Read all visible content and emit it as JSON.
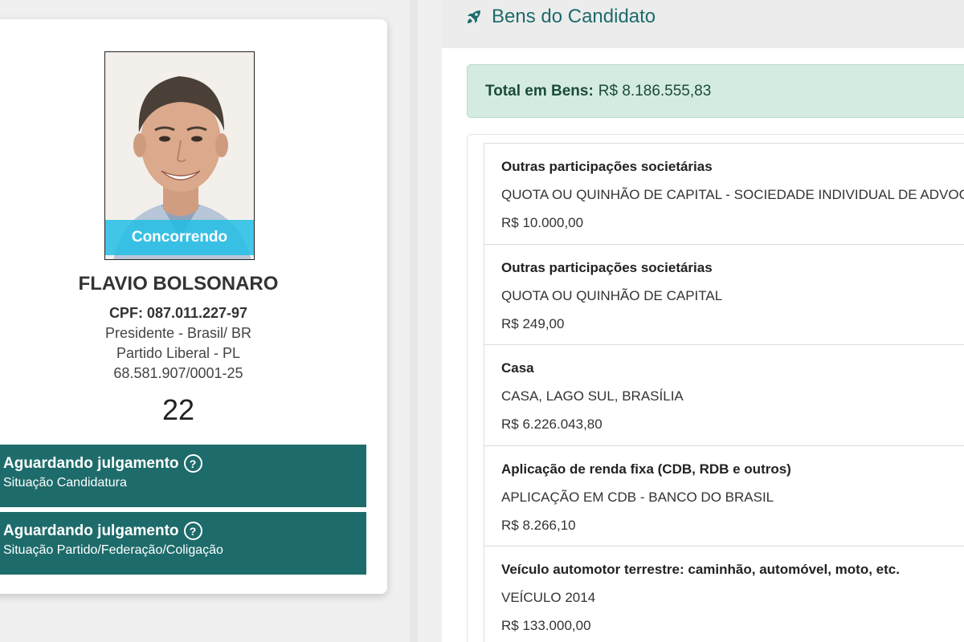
{
  "candidate": {
    "status_ribbon": "Concorrendo",
    "name": "FLAVIO BOLSONARO",
    "cpf": "CPF: 087.011.227-97",
    "role": "Presidente - Brasil/ BR",
    "party": "Partido Liberal - PL",
    "cnpj": "68.581.907/0001-25",
    "number": "22"
  },
  "situations": [
    {
      "title": "Aguardando julgamento",
      "subtitle": "Situação Candidatura",
      "icon": "question-circle-icon"
    },
    {
      "title": "Aguardando julgamento",
      "subtitle": "Situação Partido/Federação/Coligação",
      "icon": "question-circle-icon"
    }
  ],
  "assets_panel": {
    "icon": "rocket-icon",
    "title": "Bens do Candidato",
    "total_label": "Total em Bens:",
    "total_value": "R$ 8.186.555,83",
    "items": [
      {
        "type": "Outras participações societárias",
        "description": "QUOTA OU QUINHÃO DE CAPITAL - SOCIEDADE INDIVIDUAL DE ADVOCA",
        "value": "R$ 10.000,00"
      },
      {
        "type": "Outras participações societárias",
        "description": "QUOTA OU QUINHÃO DE CAPITAL",
        "value": "R$ 249,00"
      },
      {
        "type": "Casa",
        "description": "CASA, LAGO SUL, BRASÍLIA",
        "value": "R$ 6.226.043,80"
      },
      {
        "type": "Aplicação de renda fixa (CDB, RDB e outros)",
        "description": "APLICAÇÃO EM CDB - BANCO DO BRASIL",
        "value": "R$ 8.266,10"
      },
      {
        "type": "Veículo automotor terrestre: caminhão, automóvel, moto, etc.",
        "description": "VEÍCULO 2014",
        "value": "R$ 133.000,00"
      }
    ]
  },
  "colors": {
    "accent_teal": "#1e6b6b",
    "ribbon_cyan": "#21bee6",
    "total_bg": "#d4ebe1"
  }
}
